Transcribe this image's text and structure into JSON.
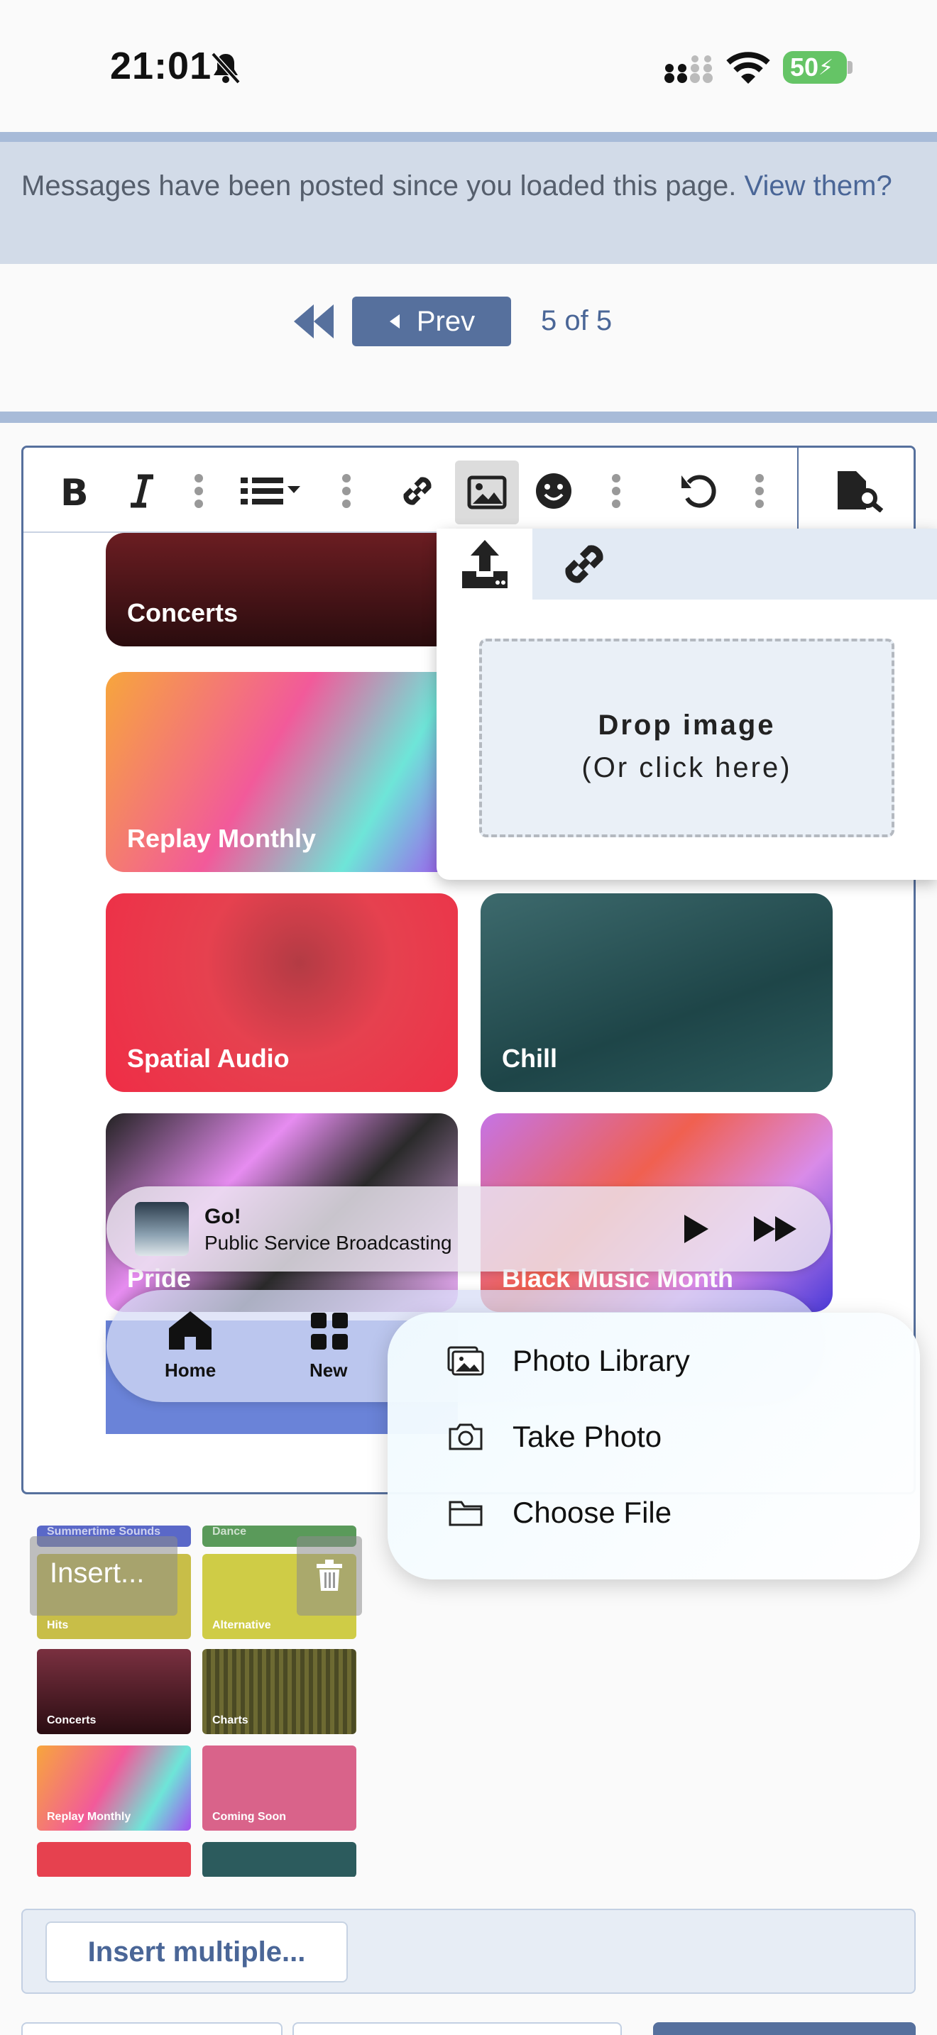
{
  "status": {
    "time": "21:01",
    "battery": "50"
  },
  "notice": {
    "text": "Messages have been posted since you loaded this page. ",
    "link": "View them?"
  },
  "pager": {
    "prev_label": "Prev",
    "page_info": "5 of 5"
  },
  "toolbar": {
    "icons": [
      "bold-icon",
      "italic-icon",
      "more-icon",
      "list-icon",
      "more-icon",
      "link-icon",
      "image-icon",
      "emoji-icon",
      "more-icon",
      "undo-icon",
      "more-icon",
      "preview-icon"
    ]
  },
  "tiles": {
    "concerts": "Concerts",
    "replay": "Replay Monthly",
    "spatial": "Spatial Audio",
    "chill": "Chill",
    "pride": "Pride",
    "black_music": "Black Music Month"
  },
  "popover": {
    "drop_title": "Drop image",
    "drop_sub": "(Or click here)"
  },
  "now_playing": {
    "title": "Go!",
    "artist": "Public Service Broadcasting"
  },
  "tabbar": {
    "home": "Home",
    "new": "New"
  },
  "menu": {
    "items": [
      "Photo Library",
      "Take Photo",
      "Choose File"
    ]
  },
  "thumbs": {
    "labels": [
      "Summertime Sounds",
      "Dance",
      "Hits",
      "Alternative",
      "Concerts",
      "Charts",
      "Replay Monthly",
      "Coming Soon"
    ]
  },
  "insert": {
    "overlay": "Insert...",
    "multiple": "Insert multiple..."
  },
  "colors": {
    "accent": "#56709d",
    "link": "#4a6697",
    "notice_bg": "#d2dbe8"
  }
}
